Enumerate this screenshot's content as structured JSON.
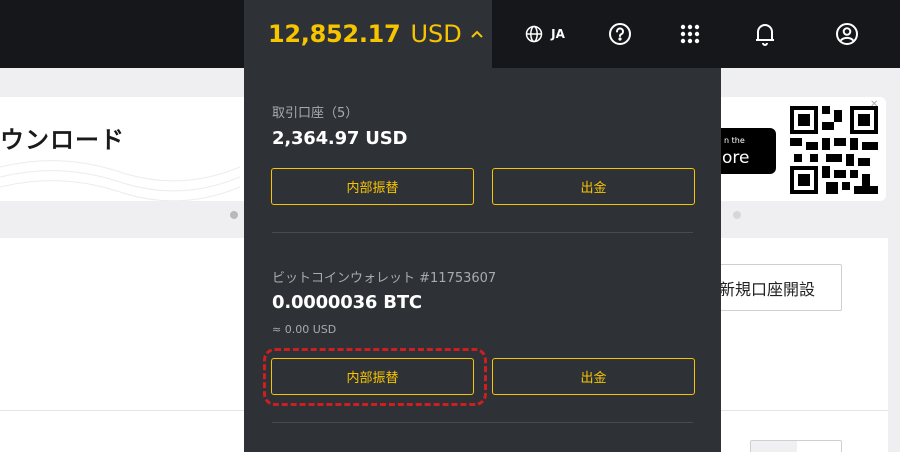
{
  "header": {
    "balance_amount": "12,852.17",
    "balance_currency": "USD",
    "language": "JA"
  },
  "background": {
    "banner_title": "ウンロード",
    "store_small": "n the",
    "store_large": "ore",
    "new_account_label": "新規口座開設"
  },
  "dropdown": {
    "trading": {
      "title": "取引口座（5）",
      "amount": "2,364.97 USD",
      "transfer_label": "内部振替",
      "withdraw_label": "出金"
    },
    "bitcoin": {
      "title": "ビットコインウォレット #11753607",
      "amount": "0.0000036 BTC",
      "approx": "≈ 0.00 USD",
      "transfer_label": "内部振替",
      "withdraw_label": "出金"
    }
  },
  "colors": {
    "accent": "#f7c400",
    "topbar": "#15171b",
    "dropdown_bg": "#2e3237",
    "highlight": "#cc1f1f"
  }
}
